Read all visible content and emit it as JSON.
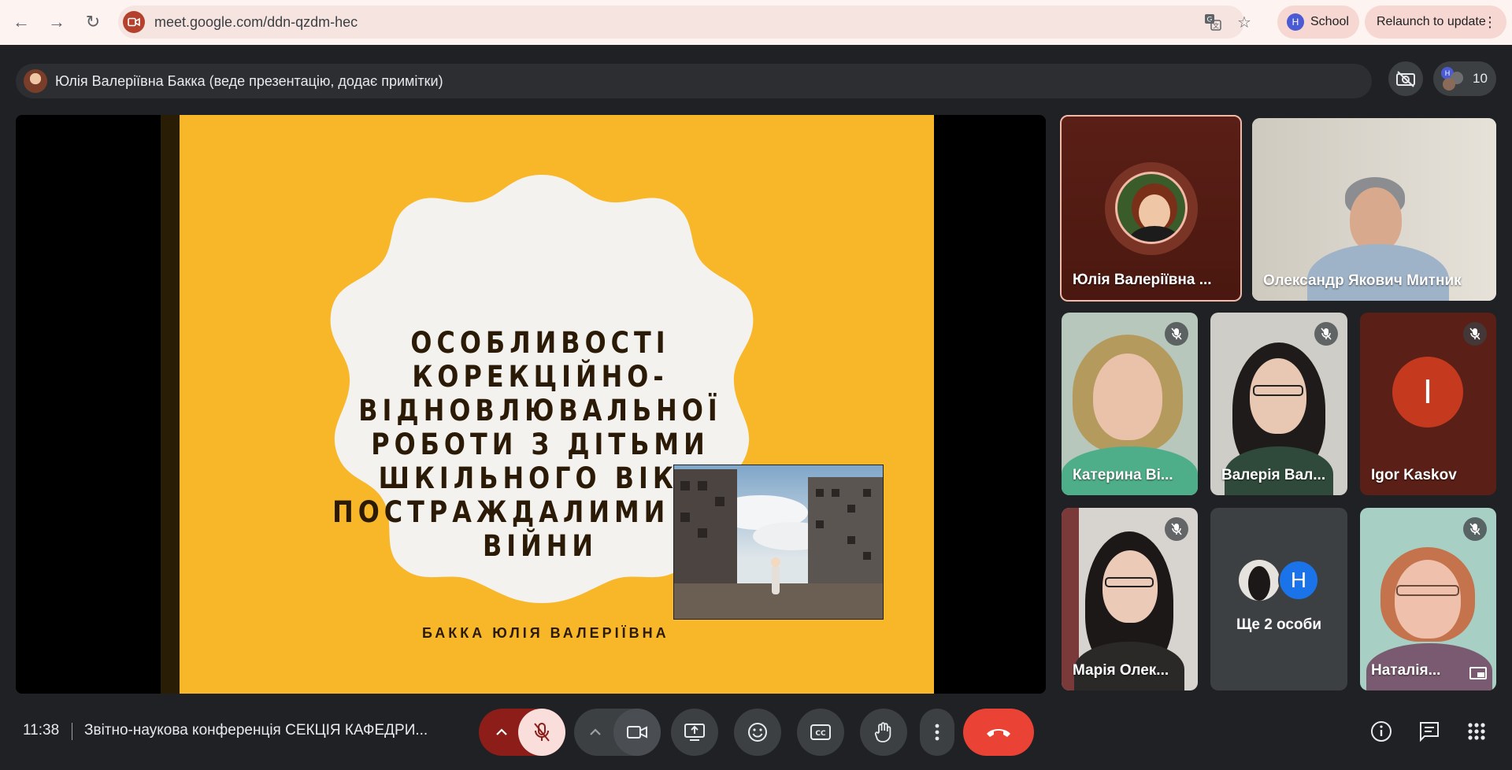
{
  "browser": {
    "url": "meet.google.com/ddn-qzdm-hec",
    "profile_label": "School",
    "profile_initial": "H",
    "relaunch_label": "Relaunch to update"
  },
  "meet": {
    "presenter_label": "Юлія Валеріївна Бакка (веде презентацію, додає примітки)",
    "participant_count": "10",
    "people_avatar_initial": "H",
    "clock": "11:38",
    "meeting_title": "Звітно-наукова конференція СЕКЦІЯ КАФЕДРИ..."
  },
  "slide": {
    "title": "ОСОБЛИВОСТІ КОРЕКЦІЙНО-ВІДНОВЛЮВАЛЬНОЇ РОБОТИ З ДІТЬМИ ШКІЛЬНОГО ВІКУ ПОСТРАЖДАЛИМИ ВІД ВІЙНИ",
    "author": "БАККА ЮЛІЯ ВАЛЕРІЇВНА"
  },
  "tiles": [
    {
      "name": "Юлія Валеріївна ..."
    },
    {
      "name": "Олександр Якович Митник"
    },
    {
      "name": "Катерина Ві..."
    },
    {
      "name": "Валерія Вал..."
    },
    {
      "name": "Igor Kaskov",
      "initial": "I"
    },
    {
      "name": "Марія Олек..."
    },
    {
      "name": "Ще 2 особи",
      "initial": "H"
    },
    {
      "name": "Наталія..."
    }
  ],
  "colors": {
    "meet_bg": "#202124",
    "slide_yellow": "#f8b629",
    "end_call_red": "#ea4335",
    "mic_off_pink": "#f9dedc",
    "mic_group_red": "#8c1d18",
    "igor_avatar": "#c5391f",
    "blue_avatar": "#1a73e8"
  },
  "icons": [
    "back-icon",
    "forward-icon",
    "reload-icon",
    "meet-site-icon",
    "translate-icon",
    "star-icon",
    "camera-off-icon",
    "mic-off-icon",
    "chevron-up-icon",
    "videocam-icon",
    "present-icon",
    "emoji-icon",
    "captions-icon",
    "hand-icon",
    "more-icon",
    "end-call-icon",
    "info-icon",
    "chat-icon",
    "apps-icon",
    "pip-icon"
  ]
}
